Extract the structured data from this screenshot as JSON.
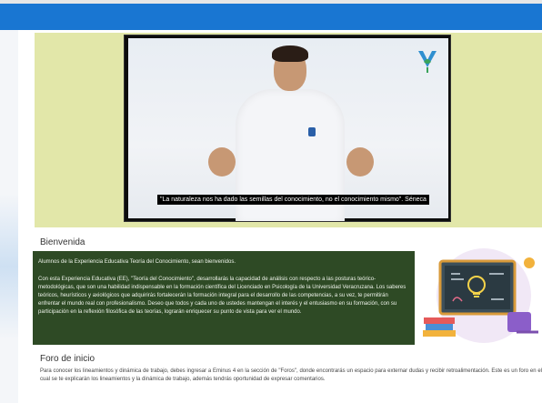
{
  "video": {
    "caption": "\"La naturaleza nos ha dado las semillas del conocimiento, no el conocimiento mismo\". Séneca",
    "logo_icon": "uv-logo-icon"
  },
  "welcome": {
    "title": "Bienvenida",
    "greeting": "Alumnos de la Experiencia Educativa Teoría del Conocimiento, sean bienvenidos.",
    "body": "Con esta Experiencia Educativa (EE), \"Teoría del Conocimiento\", desarrollarás la capacidad de análisis con respecto a las posturas teórico-metodológicas, que son una habilidad indispensable en la formación científica del Licenciado en Psicología de la Universidad Veracruzana. Los saberes teóricos, heurísticos y axiológicos que adquirirás fortalecerán la formación integral para el desarrollo de las competencias, a su vez, te permitirán enfrentar el mundo real con profesionalismo. Deseo que todos y cada uno de ustedes mantengan el interés y el entusiasmo en su formación, con su participación en la reflexión filosófica de las teorías, lograrán enriquecer su punto de vista para ver el mundo."
  },
  "forum": {
    "title": "Foro de inicio",
    "body": "Para conocer los lineamientos y dinámica de trabajo, debes ingresar a Eminus 4 en la sección de \"Foros\", donde encontrarás un espacio para externar dudas y recibir retroalimentación. Este es un foro en el cual se te explicarán los lineamientos y la dinámica de trabajo, además tendrás oportunidad de expresar comentarios."
  },
  "colors": {
    "topbar": "#1976d2",
    "video_band": "#e2e7a9",
    "welcome_box": "#2e4a25"
  }
}
